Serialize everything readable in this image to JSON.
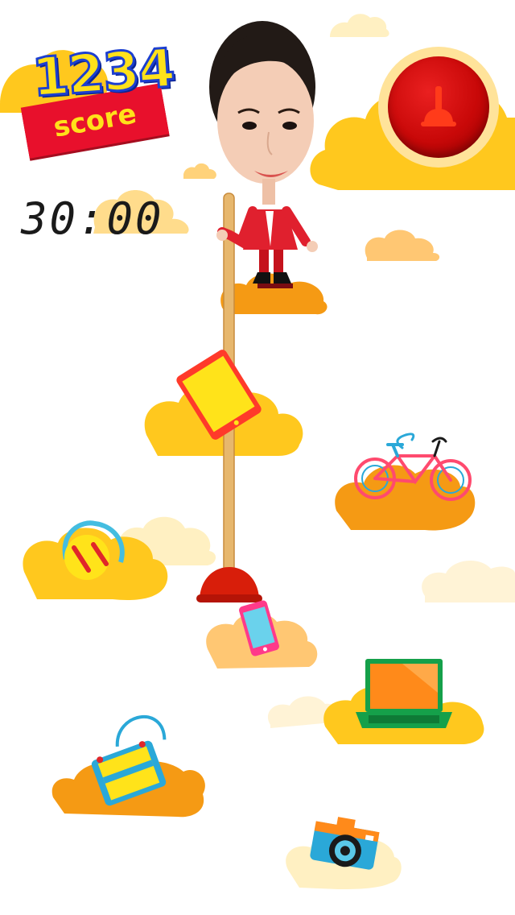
{
  "hud": {
    "score_value": "1234",
    "score_label": "score",
    "timer": "30:00"
  },
  "controls": {
    "plunger_button_icon": "plunger-icon"
  },
  "items": [
    {
      "name": "tablet-icon"
    },
    {
      "name": "bicycle-icon"
    },
    {
      "name": "headphones-icon"
    },
    {
      "name": "smartphone-icon"
    },
    {
      "name": "laptop-icon"
    },
    {
      "name": "handbag-icon"
    },
    {
      "name": "camera-icon"
    }
  ],
  "colors": {
    "cloud_yellow": "#ffc81e",
    "cloud_orange": "#f59a14",
    "cloud_pale": "#fff0c2",
    "button_red": "#c80808",
    "score_yellow": "#ffe11a",
    "score_blue": "#1c3fd0",
    "ribbon_red": "#e8102c"
  }
}
